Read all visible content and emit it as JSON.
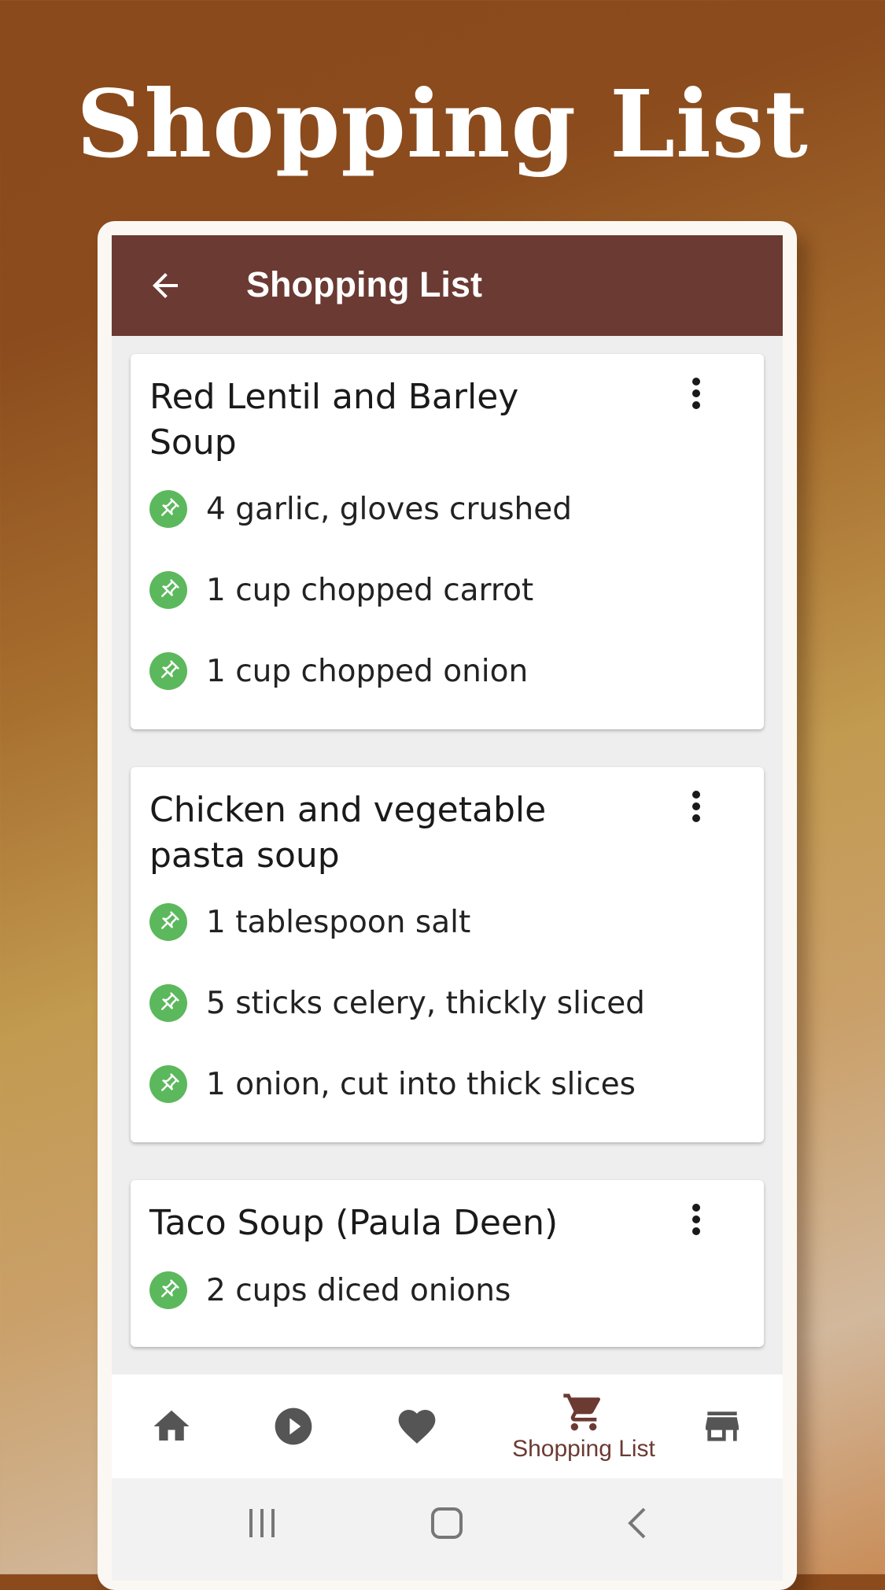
{
  "promo": {
    "title": "Shopping List"
  },
  "appbar": {
    "title": "Shopping List",
    "back_icon": "arrow-back-icon"
  },
  "cards": [
    {
      "title": "Red Lentil and Barley Soup",
      "items": [
        "4 garlic, gloves crushed",
        "1 cup chopped carrot",
        "1 cup chopped onion"
      ]
    },
    {
      "title": "Chicken and vegetable pasta soup",
      "items": [
        "1 tablespoon salt",
        "5 sticks celery, thickly sliced",
        "1 onion, cut into thick slices"
      ]
    },
    {
      "title": "Taco Soup (Paula Deen)",
      "items": [
        "2 cups diced onions"
      ]
    }
  ],
  "bottom_nav": {
    "items": [
      {
        "icon": "home-icon",
        "label": ""
      },
      {
        "icon": "play-circle-icon",
        "label": ""
      },
      {
        "icon": "heart-icon",
        "label": ""
      },
      {
        "icon": "cart-icon",
        "label": "Shopping List",
        "active": true
      },
      {
        "icon": "store-icon",
        "label": ""
      }
    ]
  },
  "colors": {
    "primary": "#6b3a33",
    "pin_green": "#5cb85c",
    "nav_icon": "#555555"
  }
}
